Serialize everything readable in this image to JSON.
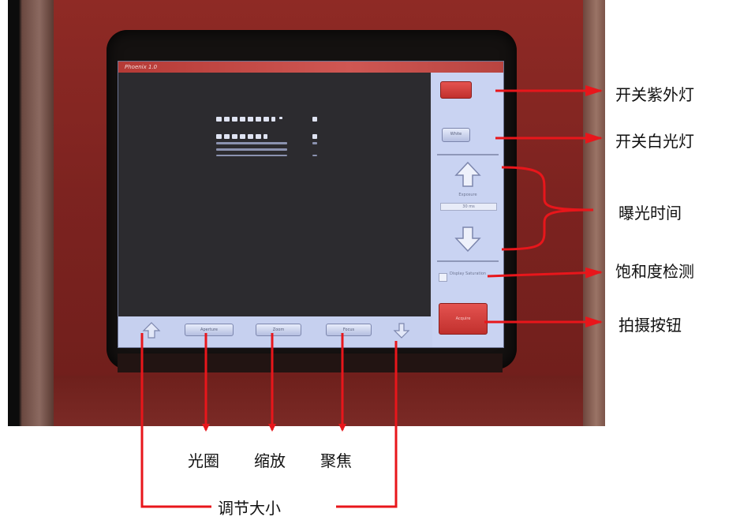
{
  "screen": {
    "title": "Phoenix 1.0",
    "buttons": {
      "uv": "",
      "white": "White",
      "exposure_label": "Exposure",
      "exposure_value": "30 ms",
      "saturation": "Display Saturation",
      "acquire": "Acquire",
      "aperture": "Aperture",
      "zoom": "Zoom",
      "focus": "Focus"
    }
  },
  "labels": {
    "uv_light": "开关紫外灯",
    "white_light": "开关白光灯",
    "exposure_time": "曝光时间",
    "saturation": "饱和度检测",
    "capture": "拍摄按钮",
    "aperture": "光圈",
    "zoom": "缩放",
    "focus": "聚焦",
    "resize": "调节大小"
  },
  "colors": {
    "annotation": "#e8161b",
    "device_red": "#8f2a25",
    "screen_bg": "#c7d1ee",
    "button_red": "#d9403c"
  },
  "icons": {
    "up_arrow": "up-arrow-icon",
    "down_arrow": "down-arrow-icon",
    "resize_up": "resize-up-icon",
    "resize_down": "resize-down-icon"
  }
}
